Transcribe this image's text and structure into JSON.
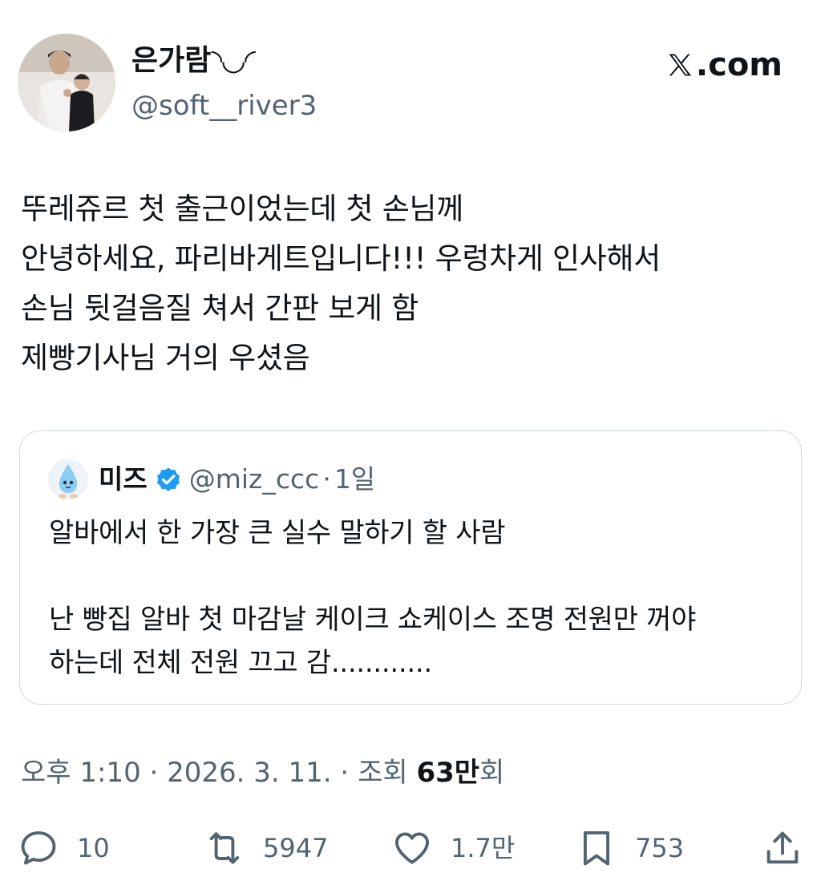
{
  "author": {
    "display_name": "은가람◝◡◜",
    "handle": "@soft__river3",
    "avatar_icon": "profile-photo"
  },
  "brand": {
    "label": ".com",
    "icon": "x-logo-icon"
  },
  "tweet": {
    "lines": [
      "뚜레쥬르 첫 출근이었는데 첫 손님께",
      "안녕하세요, 파리바게트입니다!!! 우렁차게 인사해서",
      "손님 뒷걸음질 쳐서 간판 보게 함",
      "제빵기사님 거의 우셨음"
    ]
  },
  "quote": {
    "name": "미즈",
    "handle": "@miz_ccc",
    "dot": "·",
    "time": "1일",
    "verified_icon": "verified-badge-icon",
    "lines": [
      "알바에서 한 가장 큰 실수 말하기 할 사람",
      "",
      "난 빵집 알바 첫 마감날 케이크 쇼케이스 조명 전원만 꺼야",
      "하는데 전체 전원 끄고 감............"
    ]
  },
  "meta": {
    "time": "오후 1:10",
    "sep1": " · ",
    "date": "2026. 3. 11.",
    "sep2": " · ",
    "views_label": "조회 ",
    "views_count": "63만",
    "views_suffix": "회"
  },
  "actions": {
    "replies": "10",
    "reposts": "5947",
    "likes": "1.7만",
    "bookmarks": "753"
  },
  "colors": {
    "text": "#0f1419",
    "muted": "#536471",
    "border": "#cfd9de",
    "verified": "#1d9bf0"
  }
}
